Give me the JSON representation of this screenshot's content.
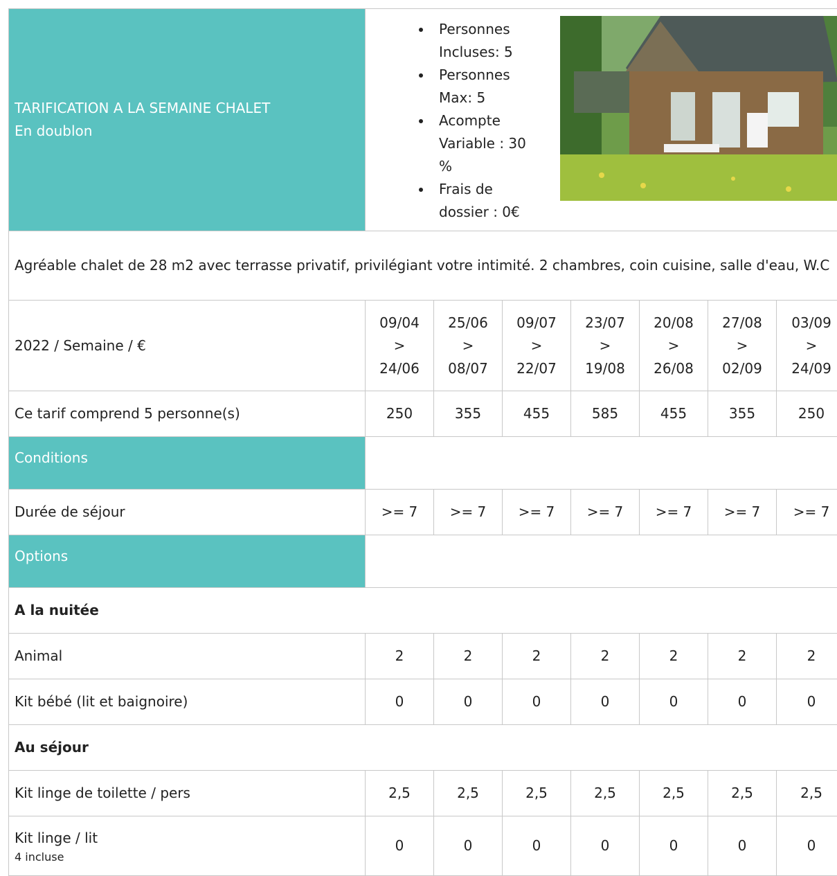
{
  "header": {
    "title": "TARIFICATION A LA SEMAINE CHALET",
    "subtitle": "En doublon",
    "features": [
      "Personnes Incluses: 5",
      "Personnes Max: 5",
      "Acompte Variable : 30 %",
      "Frais de dossier : 0€"
    ]
  },
  "description": "Agréable chalet de 28 m2 avec terrasse privatif, privilégiant votre intimité. 2 chambres, coin cuisine, salle d'eau, W.C",
  "periods_label": "2022 / Semaine / €",
  "periods": [
    {
      "from": "09/04",
      "sep": ">",
      "to": "24/06"
    },
    {
      "from": "25/06",
      "sep": ">",
      "to": "08/07"
    },
    {
      "from": "09/07",
      "sep": ">",
      "to": "22/07"
    },
    {
      "from": "23/07",
      "sep": ">",
      "to": "19/08"
    },
    {
      "from": "20/08",
      "sep": ">",
      "to": "26/08"
    },
    {
      "from": "27/08",
      "sep": ">",
      "to": "02/09"
    },
    {
      "from": "03/09",
      "sep": ">",
      "to": "24/09"
    }
  ],
  "price_row": {
    "label": "Ce tarif comprend 5 personne(s)",
    "values": [
      "250",
      "355",
      "455",
      "585",
      "455",
      "355",
      "250"
    ]
  },
  "conditions": {
    "title": "Conditions",
    "stay": {
      "label": "Durée de séjour",
      "values": [
        ">= 7",
        ">= 7",
        ">= 7",
        ">= 7",
        ">= 7",
        ">= 7",
        ">= 7"
      ]
    }
  },
  "options": {
    "title": "Options",
    "per_night": {
      "title": "A la nuitée",
      "rows": [
        {
          "label": "Animal",
          "values": [
            "2",
            "2",
            "2",
            "2",
            "2",
            "2",
            "2"
          ]
        },
        {
          "label": "Kit bébé (lit et baignoire)",
          "values": [
            "0",
            "0",
            "0",
            "0",
            "0",
            "0",
            "0"
          ]
        }
      ]
    },
    "per_stay": {
      "title": "Au séjour",
      "rows": [
        {
          "label": "Kit linge de toilette / pers",
          "note": "",
          "values": [
            "2,5",
            "2,5",
            "2,5",
            "2,5",
            "2,5",
            "2,5",
            "2,5"
          ]
        },
        {
          "label": "Kit linge / lit",
          "note": "4 incluse",
          "values": [
            "0",
            "0",
            "0",
            "0",
            "0",
            "0",
            "0"
          ]
        }
      ]
    }
  },
  "colors": {
    "accent": "#5ac2c0",
    "border": "#c8c8c8",
    "text": "#222222"
  }
}
